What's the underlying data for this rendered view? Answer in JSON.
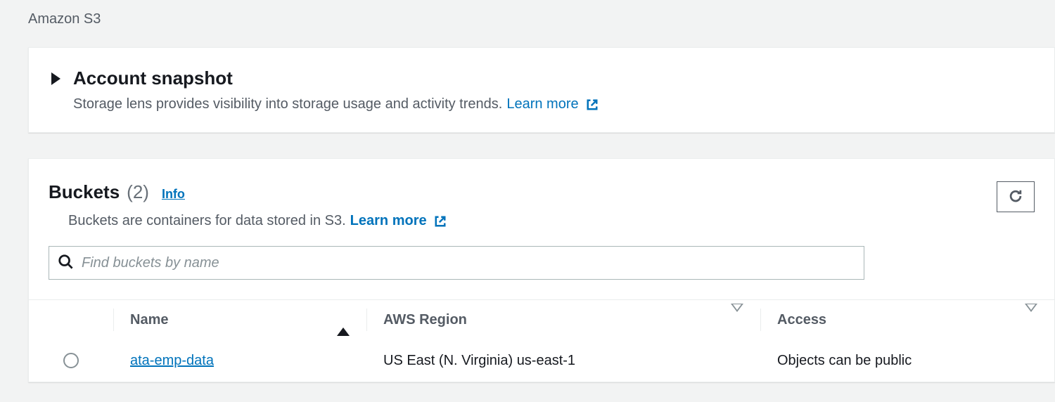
{
  "breadcrumb": "Amazon S3",
  "snapshot": {
    "title": "Account snapshot",
    "subtitle": "Storage lens provides visibility into storage usage and activity trends.",
    "learn_more": "Learn more"
  },
  "buckets": {
    "title": "Buckets",
    "count": "(2)",
    "info": "Info",
    "description": "Buckets are containers for data stored in S3.",
    "learn_more": "Learn more",
    "search_placeholder": "Find buckets by name",
    "columns": {
      "name": "Name",
      "region": "AWS Region",
      "access": "Access"
    },
    "rows": [
      {
        "name": "ata-emp-data",
        "region": "US East (N. Virginia) us-east-1",
        "access": "Objects can be public"
      }
    ]
  }
}
